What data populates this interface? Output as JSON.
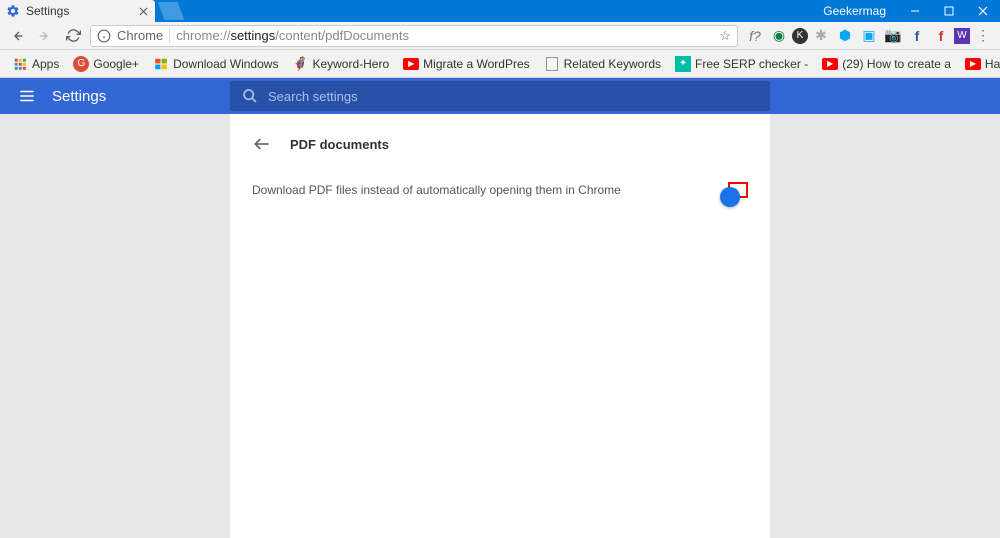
{
  "window": {
    "tab_title": "Settings",
    "titlebar_text": "Geekermag"
  },
  "toolbar": {
    "omnibox_prefix": "Chrome",
    "url_plain1": "chrome://",
    "url_bold": "settings",
    "url_plain2": "/content/pdfDocuments"
  },
  "bookmarks": {
    "apps": "Apps",
    "gplus": "Google+",
    "dlwin": "Download Windows",
    "kh": "Keyword-Hero",
    "migrate": "Migrate a WordPres",
    "related": "Related Keywords",
    "serp": "Free SERP checker -",
    "howto": "(29) How to create a",
    "hangups": "Hang Ups (Want You",
    "overflow": "»"
  },
  "settings": {
    "header_title": "Settings",
    "search_placeholder": "Search settings",
    "card_title": "PDF documents",
    "setting_label": "Download PDF files instead of automatically opening them in Chrome"
  }
}
